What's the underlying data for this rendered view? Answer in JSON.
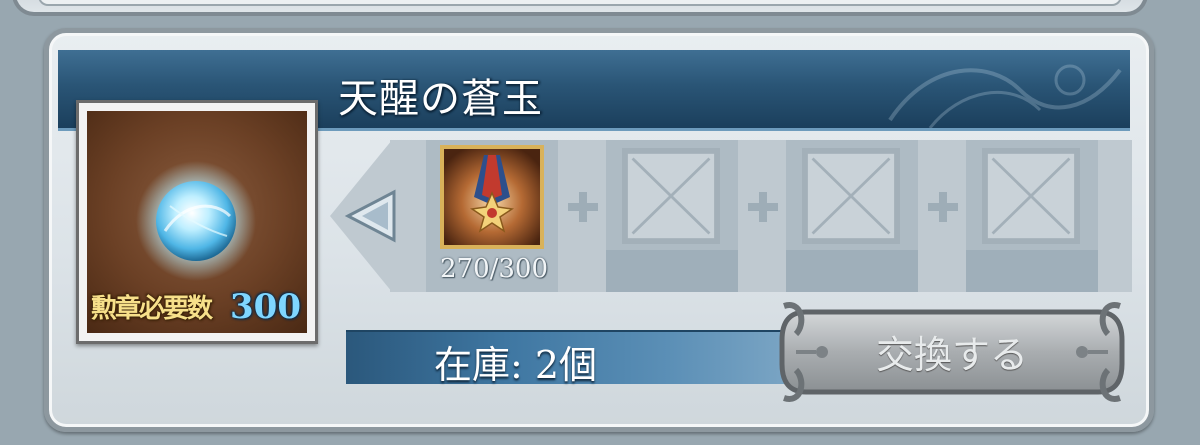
{
  "item": {
    "name": "天醒の蒼玉",
    "required_label": "勲章必要数",
    "required_count": "300",
    "icon": "blue-orb-icon"
  },
  "cost_slots": [
    {
      "icon": "medal-icon",
      "progress": "270/300",
      "filled": true
    },
    {
      "icon": "empty-slot-icon",
      "filled": false
    },
    {
      "icon": "empty-slot-icon",
      "filled": false
    },
    {
      "icon": "empty-slot-icon",
      "filled": false
    }
  ],
  "stock": {
    "label": "在庫: 2個"
  },
  "exchange_button": {
    "label": "交換する",
    "enabled": false
  },
  "colors": {
    "title_bar": "#2a5576",
    "slot_band": "#bfc9d0",
    "required_count": "#7fd6ff"
  }
}
